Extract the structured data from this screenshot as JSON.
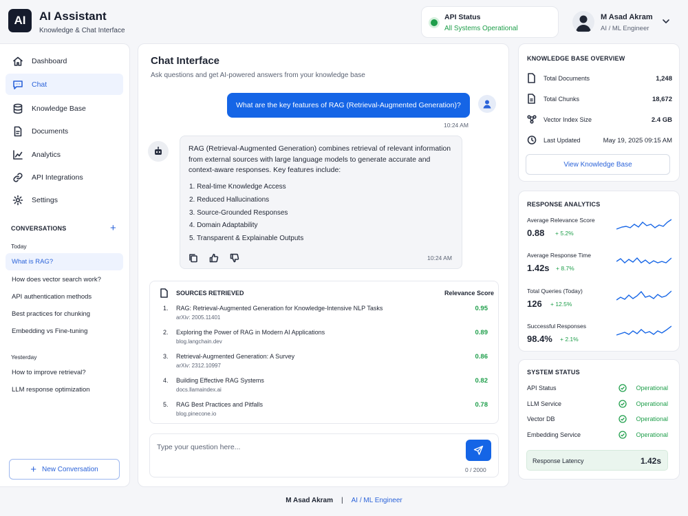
{
  "header": {
    "logo": "AI",
    "title": "AI Assistant",
    "subtitle": "Knowledge & Chat Interface",
    "api_status": {
      "title": "API Status",
      "status": "All Systems Operational",
      "color": "#1e9e4a"
    },
    "user": {
      "name": "M Asad Akram",
      "role": "AI / ML Engineer"
    }
  },
  "sidebar": {
    "nav": [
      {
        "label": "Dashboard",
        "icon": "home-icon"
      },
      {
        "label": "Chat",
        "icon": "chat-icon",
        "active": true
      },
      {
        "label": "Knowledge Base",
        "icon": "database-icon"
      },
      {
        "label": "Documents",
        "icon": "document-icon"
      },
      {
        "label": "Analytics",
        "icon": "analytics-icon"
      },
      {
        "label": "API Integrations",
        "icon": "link-icon"
      },
      {
        "label": "Settings",
        "icon": "gear-icon"
      }
    ],
    "conversations_title": "CONVERSATIONS",
    "today_label": "Today",
    "today": [
      "What is RAG?",
      "How does vector search work?",
      "API authentication methods",
      "Best practices for chunking",
      "Embedding vs Fine-tuning"
    ],
    "yesterday_label": "Yesterday",
    "yesterday": [
      "How to improve retrieval?",
      "LLM response optimization"
    ],
    "new_conversation": "New Conversation"
  },
  "chat": {
    "title": "Chat Interface",
    "subtitle": "Ask questions and get AI-powered answers from your knowledge base",
    "user_message": "What are the key features of RAG (Retrieval-Augmented Generation)?",
    "user_time": "10:24 AM",
    "bot_intro": "RAG (Retrieval-Augmented Generation) combines retrieval of relevant information from external sources with large language models to generate accurate and context-aware responses.  Key features include:",
    "features": [
      "1.  Real-time Knowledge Access",
      "2.  Reduced Hallucinations",
      "3.  Source-Grounded Responses",
      "4.  Domain Adaptability",
      "5.  Transparent & Explainable Outputs"
    ],
    "bot_time": "10:24 AM",
    "sources_title": "SOURCES RETRIEVED",
    "relevance_header": "Relevance Score",
    "sources": [
      {
        "num": "1.",
        "title": "RAG: Retrieval-Augmented Generation for Knowledge-Intensive NLP Tasks",
        "url": "arXiv: 2005.11401",
        "score": "0.95"
      },
      {
        "num": "2.",
        "title": "Exploring the Power of RAG in Modern AI Applications",
        "url": "blog.langchain.dev",
        "score": "0.89"
      },
      {
        "num": "3.",
        "title": "Retrieval-Augmented Generation: A Survey",
        "url": "arXiv: 2312.10997",
        "score": "0.86"
      },
      {
        "num": "4.",
        "title": "Building Effective RAG Systems",
        "url": "docs.llamaindex.ai",
        "score": "0.82"
      },
      {
        "num": "5.",
        "title": "RAG Best Practices and Pitfalls",
        "url": "blog.pinecone.io",
        "score": "0.78"
      }
    ],
    "input_placeholder": "Type your question here...",
    "char_count": "0 / 2000"
  },
  "knowledge_base": {
    "title": "KNOWLEDGE BASE OVERVIEW",
    "rows": [
      {
        "label": "Total Documents",
        "value": "1,248",
        "icon": "document-icon"
      },
      {
        "label": "Total Chunks",
        "value": "18,672",
        "icon": "chunk-icon"
      },
      {
        "label": "Vector Index Size",
        "value": "2.4 GB",
        "icon": "vector-icon"
      },
      {
        "label": "Last Updated",
        "value": "May 19, 2025 09:15 AM",
        "icon": "clock-icon"
      }
    ],
    "button": "View Knowledge Base"
  },
  "analytics": {
    "title": "RESPONSE ANALYTICS",
    "items": [
      {
        "label": "Average Relevance Score",
        "value": "0.88",
        "delta": "+ 5.2%"
      },
      {
        "label": "Average Response Time",
        "value": "1.42s",
        "delta": "+ 8.7%"
      },
      {
        "label": "Total Queries (Today)",
        "value": "126",
        "delta": "+ 12.5%"
      },
      {
        "label": "Successful Responses",
        "value": "98.4%",
        "delta": "+ 2.1%"
      }
    ]
  },
  "system_status": {
    "title": "SYSTEM STATUS",
    "rows": [
      {
        "label": "API Status",
        "status": "Operational"
      },
      {
        "label": "LLM Service",
        "status": "Operational"
      },
      {
        "label": "Vector DB",
        "status": "Operational"
      },
      {
        "label": "Embedding Service",
        "status": "Operational"
      }
    ],
    "latency_label": "Response Latency",
    "latency_value": "1.42s"
  },
  "footer": {
    "name": "M Asad Akram",
    "separator": "|",
    "role": "AI / ML Engineer"
  },
  "colors": {
    "accent": "#1565e6",
    "success": "#1e9e4a",
    "dark": "#151b2c"
  }
}
